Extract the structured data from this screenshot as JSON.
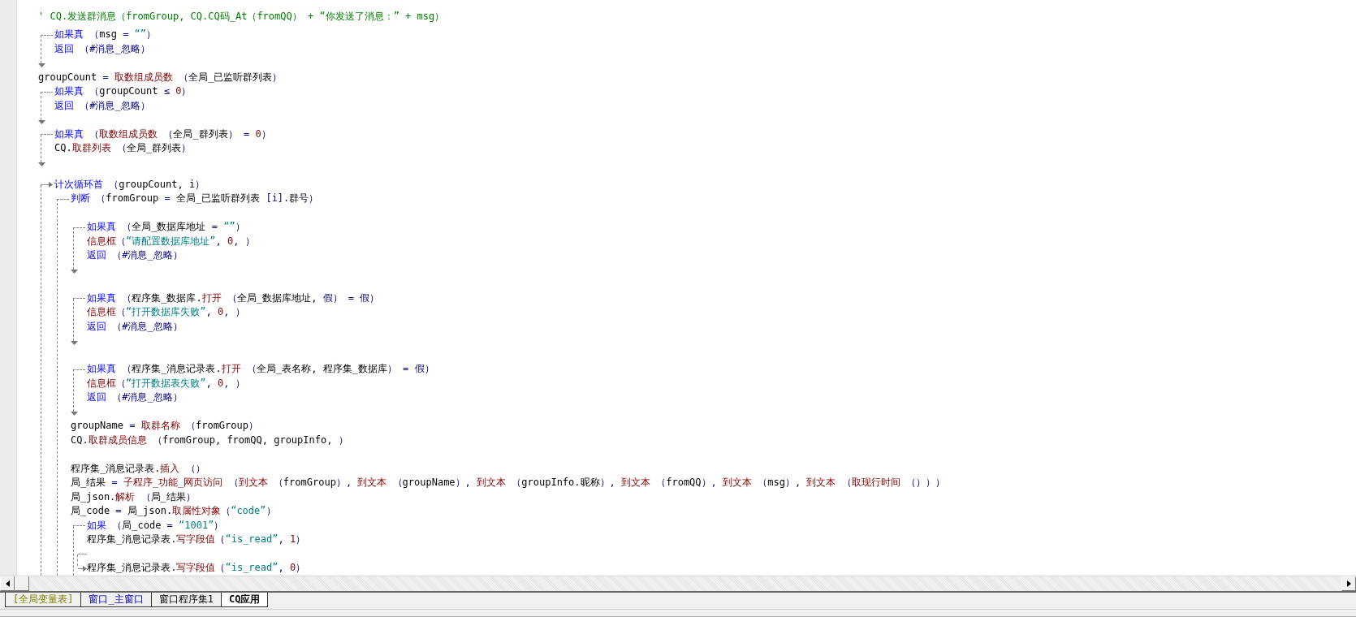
{
  "code": [
    {
      "kind": "code",
      "tokens": [
        {
          "kind": "comment",
          "text": "' CQ.发送群消息（fromGroup, CQ.CQ码_At（fromQQ） + “你发送了消息：” + msg）"
        }
      ]
    },
    {
      "kind": "blank"
    },
    {
      "kind": "if",
      "end_shown": true,
      "header": [
        {
          "kind": "kw",
          "text": "如果真"
        },
        {
          "kind": "op",
          "text": " （"
        },
        {
          "kind": "plain",
          "text": "msg"
        },
        {
          "kind": "op",
          "text": " = "
        },
        {
          "kind": "str",
          "text": "“”"
        },
        {
          "kind": "op",
          "text": "）"
        }
      ],
      "children": [
        {
          "kind": "code",
          "tokens": [
            {
              "kind": "kw",
              "text": "返回"
            },
            {
              "kind": "op",
              "text": " （#消息_忽略）"
            }
          ]
        }
      ]
    },
    {
      "kind": "code",
      "tokens": [
        {
          "kind": "plain",
          "text": "groupCount"
        },
        {
          "kind": "op",
          "text": " = "
        },
        {
          "kind": "fn",
          "text": "取数组成员数"
        },
        {
          "kind": "op",
          "text": " （"
        },
        {
          "kind": "plain",
          "text": "全局_已监听群列表"
        },
        {
          "kind": "op",
          "text": "）"
        }
      ]
    },
    {
      "kind": "if",
      "end_shown": true,
      "header": [
        {
          "kind": "kw",
          "text": "如果真"
        },
        {
          "kind": "op",
          "text": " （"
        },
        {
          "kind": "plain",
          "text": "groupCount"
        },
        {
          "kind": "op",
          "text": " ≤ "
        },
        {
          "kind": "fn",
          "text": "0"
        },
        {
          "kind": "op",
          "text": "）"
        }
      ],
      "children": [
        {
          "kind": "code",
          "tokens": [
            {
              "kind": "kw",
              "text": "返回"
            },
            {
              "kind": "op",
              "text": " （#消息_忽略）"
            }
          ]
        }
      ]
    },
    {
      "kind": "if",
      "end_shown": true,
      "header": [
        {
          "kind": "kw",
          "text": "如果真"
        },
        {
          "kind": "op",
          "text": " （"
        },
        {
          "kind": "fn",
          "text": "取数组成员数"
        },
        {
          "kind": "op",
          "text": " （"
        },
        {
          "kind": "plain",
          "text": "全局_群列表"
        },
        {
          "kind": "op",
          "text": "） = "
        },
        {
          "kind": "fn",
          "text": "0"
        },
        {
          "kind": "op",
          "text": "）"
        }
      ],
      "children": [
        {
          "kind": "code",
          "tokens": [
            {
              "kind": "plain",
              "text": "CQ."
            },
            {
              "kind": "fn",
              "text": "取群列表"
            },
            {
              "kind": "op",
              "text": " （"
            },
            {
              "kind": "plain",
              "text": "全局_群列表"
            },
            {
              "kind": "op",
              "text": "）"
            }
          ]
        }
      ]
    },
    {
      "kind": "blank"
    },
    {
      "kind": "blank"
    },
    {
      "kind": "loop",
      "end_shown": false,
      "header": [
        {
          "kind": "kw",
          "text": "计次循环首"
        },
        {
          "kind": "op",
          "text": " （"
        },
        {
          "kind": "plain",
          "text": "groupCount, i"
        },
        {
          "kind": "op",
          "text": "）"
        }
      ],
      "children": [
        {
          "kind": "if",
          "end_shown": false,
          "header": [
            {
              "kind": "kw",
              "text": "判断"
            },
            {
              "kind": "op",
              "text": " （"
            },
            {
              "kind": "plain",
              "text": "fromGroup"
            },
            {
              "kind": "op",
              "text": " = "
            },
            {
              "kind": "plain",
              "text": "全局_已监听群列表"
            },
            {
              "kind": "op",
              "text": " [i]."
            },
            {
              "kind": "plain",
              "text": "群号"
            },
            {
              "kind": "op",
              "text": "）"
            }
          ],
          "children": [
            {
              "kind": "blank"
            },
            {
              "kind": "if",
              "end_shown": true,
              "header": [
                {
                  "kind": "kw",
                  "text": "如果真"
                },
                {
                  "kind": "op",
                  "text": " （"
                },
                {
                  "kind": "plain",
                  "text": "全局_数据库地址"
                },
                {
                  "kind": "op",
                  "text": " = "
                },
                {
                  "kind": "str",
                  "text": "“”"
                },
                {
                  "kind": "op",
                  "text": "）"
                }
              ],
              "children": [
                {
                  "kind": "code",
                  "tokens": [
                    {
                      "kind": "fn",
                      "text": "信息框"
                    },
                    {
                      "kind": "op",
                      "text": "（"
                    },
                    {
                      "kind": "str",
                      "text": "“请配置数据库地址”"
                    },
                    {
                      "kind": "op",
                      "text": ", "
                    },
                    {
                      "kind": "fn",
                      "text": "0"
                    },
                    {
                      "kind": "op",
                      "text": ", ）"
                    }
                  ]
                },
                {
                  "kind": "code",
                  "tokens": [
                    {
                      "kind": "kw",
                      "text": "返回"
                    },
                    {
                      "kind": "op",
                      "text": " （#消息_忽略）"
                    }
                  ]
                }
              ]
            },
            {
              "kind": "blank"
            },
            {
              "kind": "if",
              "end_shown": true,
              "header": [
                {
                  "kind": "kw",
                  "text": "如果真"
                },
                {
                  "kind": "op",
                  "text": " （"
                },
                {
                  "kind": "plain",
                  "text": "程序集_数据库."
                },
                {
                  "kind": "fn",
                  "text": "打开"
                },
                {
                  "kind": "op",
                  "text": " （"
                },
                {
                  "kind": "plain",
                  "text": "全局_数据库地址, "
                },
                {
                  "kind": "op",
                  "text": "假） = 假）"
                }
              ],
              "children": [
                {
                  "kind": "code",
                  "tokens": [
                    {
                      "kind": "fn",
                      "text": "信息框"
                    },
                    {
                      "kind": "op",
                      "text": "（"
                    },
                    {
                      "kind": "str",
                      "text": "“打开数据库失败”"
                    },
                    {
                      "kind": "op",
                      "text": ", "
                    },
                    {
                      "kind": "fn",
                      "text": "0"
                    },
                    {
                      "kind": "op",
                      "text": ", ）"
                    }
                  ]
                },
                {
                  "kind": "code",
                  "tokens": [
                    {
                      "kind": "kw",
                      "text": "返回"
                    },
                    {
                      "kind": "op",
                      "text": " （#消息_忽略）"
                    }
                  ]
                }
              ]
            },
            {
              "kind": "blank"
            },
            {
              "kind": "if",
              "end_shown": true,
              "header": [
                {
                  "kind": "kw",
                  "text": "如果真"
                },
                {
                  "kind": "op",
                  "text": " （"
                },
                {
                  "kind": "plain",
                  "text": "程序集_消息记录表."
                },
                {
                  "kind": "fn",
                  "text": "打开"
                },
                {
                  "kind": "op",
                  "text": " （"
                },
                {
                  "kind": "plain",
                  "text": "全局_表名称, 程序集_数据库"
                },
                {
                  "kind": "op",
                  "text": "） = 假）"
                }
              ],
              "children": [
                {
                  "kind": "code",
                  "tokens": [
                    {
                      "kind": "fn",
                      "text": "信息框"
                    },
                    {
                      "kind": "op",
                      "text": "（"
                    },
                    {
                      "kind": "str",
                      "text": "“打开数据表失败”"
                    },
                    {
                      "kind": "op",
                      "text": ", "
                    },
                    {
                      "kind": "fn",
                      "text": "0"
                    },
                    {
                      "kind": "op",
                      "text": ", ）"
                    }
                  ]
                },
                {
                  "kind": "code",
                  "tokens": [
                    {
                      "kind": "kw",
                      "text": "返回"
                    },
                    {
                      "kind": "op",
                      "text": " （#消息_忽略）"
                    }
                  ]
                }
              ]
            },
            {
              "kind": "code",
              "tokens": [
                {
                  "kind": "plain",
                  "text": "groupName"
                },
                {
                  "kind": "op",
                  "text": " = "
                },
                {
                  "kind": "fn",
                  "text": "取群名称"
                },
                {
                  "kind": "op",
                  "text": " （"
                },
                {
                  "kind": "plain",
                  "text": "fromGroup"
                },
                {
                  "kind": "op",
                  "text": "）"
                }
              ]
            },
            {
              "kind": "code",
              "tokens": [
                {
                  "kind": "plain",
                  "text": "CQ."
                },
                {
                  "kind": "fn",
                  "text": "取群成员信息"
                },
                {
                  "kind": "op",
                  "text": " （"
                },
                {
                  "kind": "plain",
                  "text": "fromGroup, fromQQ, groupInfo, "
                },
                {
                  "kind": "op",
                  "text": "）"
                }
              ]
            },
            {
              "kind": "blank"
            },
            {
              "kind": "code",
              "tokens": [
                {
                  "kind": "plain",
                  "text": "程序集_消息记录表."
                },
                {
                  "kind": "fn",
                  "text": "插入"
                },
                {
                  "kind": "op",
                  "text": " （）"
                }
              ]
            },
            {
              "kind": "code",
              "tokens": [
                {
                  "kind": "plain",
                  "text": "局_结果"
                },
                {
                  "kind": "op",
                  "text": " = "
                },
                {
                  "kind": "fn",
                  "text": "子程序_功能_网页访问"
                },
                {
                  "kind": "op",
                  "text": " （"
                },
                {
                  "kind": "fn",
                  "text": "到文本"
                },
                {
                  "kind": "op",
                  "text": " （"
                },
                {
                  "kind": "plain",
                  "text": "fromGroup"
                },
                {
                  "kind": "op",
                  "text": "）, "
                },
                {
                  "kind": "fn",
                  "text": "到文本"
                },
                {
                  "kind": "op",
                  "text": " （"
                },
                {
                  "kind": "plain",
                  "text": "groupName"
                },
                {
                  "kind": "op",
                  "text": "）, "
                },
                {
                  "kind": "fn",
                  "text": "到文本"
                },
                {
                  "kind": "op",
                  "text": " （"
                },
                {
                  "kind": "plain",
                  "text": "groupInfo.昵称"
                },
                {
                  "kind": "op",
                  "text": "）, "
                },
                {
                  "kind": "fn",
                  "text": "到文本"
                },
                {
                  "kind": "op",
                  "text": " （"
                },
                {
                  "kind": "plain",
                  "text": "fromQQ"
                },
                {
                  "kind": "op",
                  "text": "）, "
                },
                {
                  "kind": "fn",
                  "text": "到文本"
                },
                {
                  "kind": "op",
                  "text": " （"
                },
                {
                  "kind": "plain",
                  "text": "msg"
                },
                {
                  "kind": "op",
                  "text": "）, "
                },
                {
                  "kind": "fn",
                  "text": "到文本"
                },
                {
                  "kind": "op",
                  "text": " （"
                },
                {
                  "kind": "fn",
                  "text": "取现行时间"
                },
                {
                  "kind": "op",
                  "text": " （）））"
                }
              ]
            },
            {
              "kind": "code",
              "tokens": [
                {
                  "kind": "plain",
                  "text": "局_json."
                },
                {
                  "kind": "fn",
                  "text": "解析"
                },
                {
                  "kind": "op",
                  "text": " （"
                },
                {
                  "kind": "plain",
                  "text": "局_结果"
                },
                {
                  "kind": "op",
                  "text": "）"
                }
              ]
            },
            {
              "kind": "code",
              "tokens": [
                {
                  "kind": "plain",
                  "text": "局_code"
                },
                {
                  "kind": "op",
                  "text": " = "
                },
                {
                  "kind": "plain",
                  "text": "局_json."
                },
                {
                  "kind": "fn",
                  "text": "取属性对象"
                },
                {
                  "kind": "op",
                  "text": "（"
                },
                {
                  "kind": "str",
                  "text": "“code”"
                },
                {
                  "kind": "op",
                  "text": "）"
                }
              ]
            },
            {
              "kind": "if",
              "end_shown": false,
              "header": [
                {
                  "kind": "kw",
                  "text": "如果"
                },
                {
                  "kind": "op",
                  "text": " （"
                },
                {
                  "kind": "plain",
                  "text": "局_code"
                },
                {
                  "kind": "op",
                  "text": " = "
                },
                {
                  "kind": "str",
                  "text": "“1001”"
                },
                {
                  "kind": "op",
                  "text": "）"
                }
              ],
              "children": [
                {
                  "kind": "code",
                  "tokens": [
                    {
                      "kind": "plain",
                      "text": "程序集_消息记录表."
                    },
                    {
                      "kind": "fn",
                      "text": "写字段值"
                    },
                    {
                      "kind": "op",
                      "text": "（"
                    },
                    {
                      "kind": "str",
                      "text": "“is_read”"
                    },
                    {
                      "kind": "op",
                      "text": ", "
                    },
                    {
                      "kind": "fn",
                      "text": "1"
                    },
                    {
                      "kind": "op",
                      "text": "）"
                    }
                  ]
                }
              ],
              "else": [
                {
                  "kind": "code",
                  "tokens": [
                    {
                      "kind": "plain",
                      "text": "程序集_消息记录表."
                    },
                    {
                      "kind": "fn",
                      "text": "写字段值"
                    },
                    {
                      "kind": "op",
                      "text": "（"
                    },
                    {
                      "kind": "str",
                      "text": "“is_read”"
                    },
                    {
                      "kind": "op",
                      "text": ", "
                    },
                    {
                      "kind": "fn",
                      "text": "0"
                    },
                    {
                      "kind": "op",
                      "text": "）"
                    }
                  ]
                }
              ]
            }
          ]
        }
      ]
    }
  ],
  "tabs": [
    {
      "label": "[全局变量表]",
      "selected": false,
      "kind": "table"
    },
    {
      "label": "窗口_主窗口",
      "selected": false,
      "kind": "window"
    },
    {
      "label": "窗口程序集1",
      "selected": false,
      "kind": "module"
    },
    {
      "label": "CQ应用",
      "selected": true,
      "kind": "module"
    }
  ]
}
